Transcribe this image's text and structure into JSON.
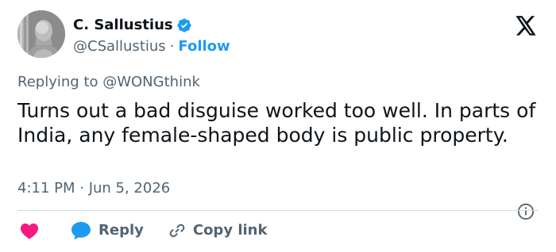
{
  "author": {
    "display_name": "C. Sallustius",
    "handle": "@CSallustius",
    "separator": "·",
    "follow_label": "Follow",
    "avatar_icon": "bust-statue-avatar",
    "verified_icon": "verified-badge-icon"
  },
  "platform_icon": "x-logo-icon",
  "reply_context": {
    "prefix": "Replying to",
    "mention": "@WONGthink"
  },
  "tweet": {
    "text": "Turns out a bad disguise worked too well. In parts of India, any female-shaped body is public property.",
    "timestamp": "4:11 PM · Jun 5, 2026"
  },
  "actions": {
    "like_icon": "heart-icon",
    "reply_icon": "speech-bubble-icon",
    "reply_label": "Reply",
    "copy_icon": "link-icon",
    "copy_label": "Copy link",
    "info_icon": "info-icon"
  },
  "colors": {
    "accent": "#1d9bf0",
    "like": "#f91880",
    "secondary_text": "#536471",
    "primary_text": "#0f1419",
    "divider": "#cfd9de"
  }
}
